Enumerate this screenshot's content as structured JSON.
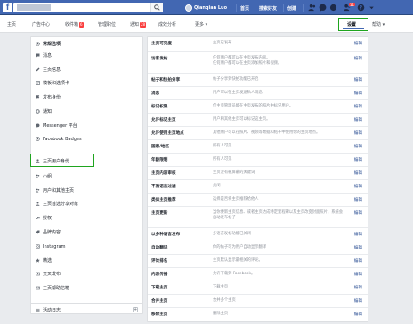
{
  "topbar": {
    "logo": "f",
    "search_placeholder": "",
    "profile_name": "Qianqian Luo",
    "links": [
      "首页",
      "搜索好友",
      "创建"
    ],
    "friend_badge": "11"
  },
  "pagebar": {
    "tabs": [
      {
        "label": "主页"
      },
      {
        "label": "广告中心"
      },
      {
        "label": "收件箱",
        "badge": "6"
      },
      {
        "label": "管理职位"
      },
      {
        "label": "通知",
        "badge": "28"
      },
      {
        "label": "成效分析"
      },
      {
        "label": "更多 ▾"
      }
    ],
    "settings_label": "设置",
    "help_label": "帮助 ▾"
  },
  "sidebar": {
    "items": [
      {
        "label": "常规选项",
        "icon": "gear-icon"
      },
      {
        "label": "消息",
        "icon": "message-icon"
      },
      {
        "label": "主页信息",
        "icon": "edit-icon"
      },
      {
        "label": "模板和选项卡",
        "icon": "grid-icon"
      },
      {
        "label": "发布身份",
        "icon": "flag-icon"
      },
      {
        "label": "通知",
        "icon": "globe-icon"
      },
      {
        "label": "Messenger 平台",
        "icon": "messenger-icon"
      },
      {
        "label": "Facebook Badges",
        "icon": "badge-icon"
      },
      {
        "label": "主页用户身份",
        "icon": "person-icon"
      },
      {
        "label": "小组",
        "icon": "group-icon"
      },
      {
        "label": "用户和其他主页",
        "icon": "people-icon"
      },
      {
        "label": "主页首选分享对象",
        "icon": "audience-icon"
      },
      {
        "label": "授权",
        "icon": "key-icon"
      },
      {
        "label": "品牌内容",
        "icon": "brand-icon"
      },
      {
        "label": "Instagram",
        "icon": "instagram-icon"
      },
      {
        "label": "精选",
        "icon": "star-icon"
      },
      {
        "label": "交叉发布",
        "icon": "crosspost-icon"
      },
      {
        "label": "主页帮助信箱",
        "icon": "mailbox-icon"
      }
    ],
    "footer_item": {
      "label": "活动日志",
      "icon": "list-icon"
    }
  },
  "settings": {
    "edit_label": "编辑",
    "rows": [
      {
        "label": "主页可见度",
        "value": "主页已发布"
      },
      {
        "label": "访客发帖",
        "value": "任何用户都可以在主页发布内容。\n任何用户都可以在主页添加照片和视频。"
      },
      {
        "label": "帖子和快拍分享",
        "value": "帖子分享到快拍功能已开启"
      },
      {
        "label": "消息",
        "value": "用户可以在主页发送私人消息"
      },
      {
        "label": "标记权限",
        "value": "仅主页管理员能在主页发布的照片中标记用户。"
      },
      {
        "label": "允许标记主页",
        "value": "用户和其他主页可以标记这主页。"
      },
      {
        "label": "允许使用主页地点",
        "value": "其他用户可以在照片、视频等数据和帖子中使用你的主页地点。"
      },
      {
        "label": "国家/地区",
        "value": "所有人可见"
      },
      {
        "label": "年龄限制",
        "value": "所有人可见"
      },
      {
        "label": "主页内容审核",
        "value": "主页没有被屏蔽的关键词"
      },
      {
        "label": "不雅语言过滤",
        "value": "关闭"
      },
      {
        "label": "类似主页推荐",
        "value": "选择是否将主页推荐给他人"
      },
      {
        "label": "主页更新",
        "value": "当你更新主页信息、或者主页达成特定里程碑以及主页改变封面照片、系统会自动发布帖子"
      },
      {
        "label": "以多种语言发布",
        "value": "多语言发帖功能已关闭"
      },
      {
        "label": "自动翻译",
        "value": "你的帖子可为用户自动显示翻译"
      },
      {
        "label": "评论排名",
        "value": "主页默认显示最相关的评论。"
      },
      {
        "label": "内容传播",
        "value": "允许下载到 Facebook。"
      },
      {
        "label": "下载主页",
        "value": "下载主页"
      },
      {
        "label": "合并主页",
        "value": "合并多个主页"
      },
      {
        "label": "移除主页",
        "value": "删除主页"
      }
    ]
  }
}
